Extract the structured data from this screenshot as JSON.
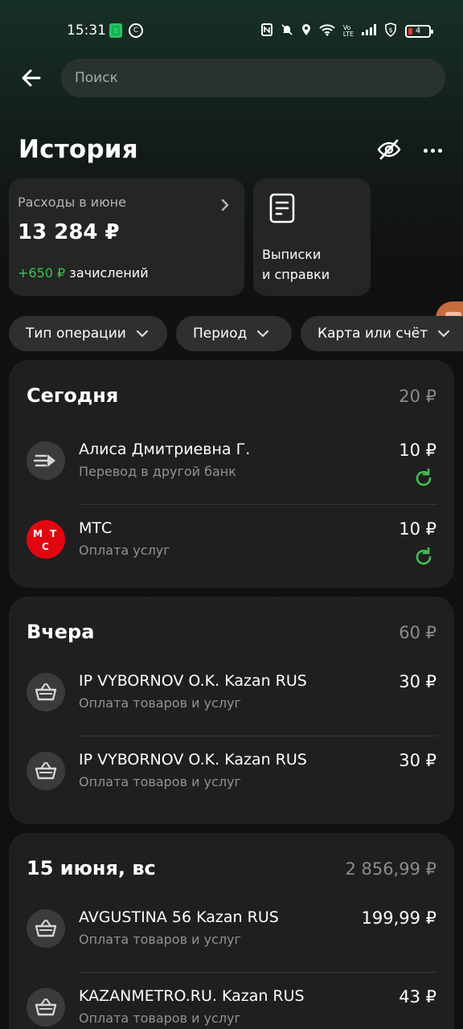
{
  "status_bar": {
    "time": "15:31",
    "battery": "4",
    "icons": [
      "app-green-icon",
      "app-c-icon",
      "nfc-icon",
      "mute-icon",
      "location-icon",
      "wifi-icon",
      "volte-icon",
      "signal-icon",
      "shield-icon",
      "battery-icon"
    ]
  },
  "header": {
    "search_placeholder": "Поиск",
    "title": "История"
  },
  "summary": {
    "expenses_label": "Расходы в июне",
    "expenses_amount": "13 284 ₽",
    "income_value": "+650 ₽",
    "income_suffix": " зачислений",
    "statements_line1": "Выписки",
    "statements_line2": "и справки"
  },
  "filters": {
    "type": "Тип операции",
    "period": "Период",
    "card": "Карта или счёт"
  },
  "groups": [
    {
      "title": "Сегодня",
      "total": "20 ₽",
      "items": [
        {
          "name": "Алиса Дмитриевна Г.",
          "sub": "Перевод в другой банк",
          "amount": "10 ₽"
        },
        {
          "name": "МТС",
          "sub": "Оплата услуг",
          "amount": "10 ₽"
        }
      ]
    },
    {
      "title": "Вчера",
      "total": "60 ₽",
      "items": [
        {
          "name": "IP VYBORNOV O.K. Kazan RUS",
          "sub": "Оплата товаров и услуг",
          "amount": "30 ₽"
        },
        {
          "name": "IP VYBORNOV O.K. Kazan RUS",
          "sub": "Оплата товаров и услуг",
          "amount": "30 ₽"
        }
      ]
    },
    {
      "title": "15 июня, вс",
      "total": "2 856,99 ₽",
      "items": [
        {
          "name": "AVGUSTINA 56 Kazan RUS",
          "sub": "Оплата товаров и услуг",
          "amount": "199,99 ₽"
        },
        {
          "name": "KAZANMETRO.RU. Kazan RUS",
          "sub": "Оплата товаров и услуг",
          "amount": "43 ₽"
        }
      ]
    }
  ],
  "mts_logo_letters": [
    "М",
    "Т",
    "С"
  ],
  "colors": {
    "accent_green": "#3fbf55",
    "mts_red": "#e30611"
  }
}
